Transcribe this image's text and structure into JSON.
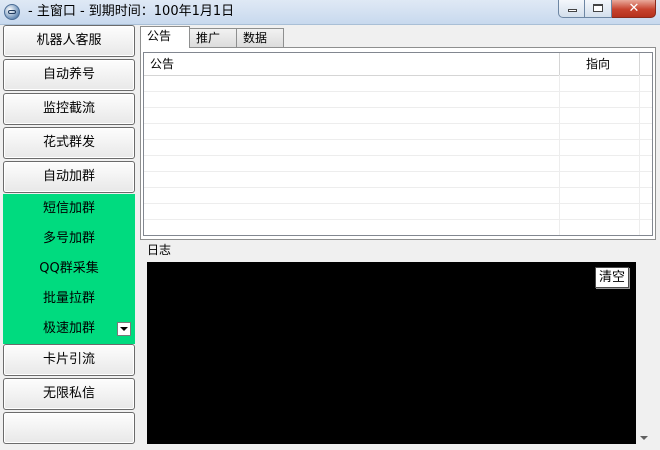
{
  "window": {
    "title": "- 主窗口 -  到期时间：100年1月1日"
  },
  "nav": {
    "items": [
      {
        "label": "机器人客服"
      },
      {
        "label": "自动养号"
      },
      {
        "label": "监控截流"
      },
      {
        "label": "花式群发"
      },
      {
        "label": "自动加群"
      }
    ],
    "submenu": [
      {
        "label": "短信加群"
      },
      {
        "label": "多号加群"
      },
      {
        "label": "QQ群采集"
      },
      {
        "label": "批量拉群"
      },
      {
        "label": "极速加群"
      }
    ],
    "items_after": [
      {
        "label": "卡片引流"
      },
      {
        "label": "无限私信"
      },
      {
        "label": ""
      }
    ],
    "submenu_color": "#00db7f"
  },
  "tabs": [
    {
      "label": "公告",
      "active": true
    },
    {
      "label": "推广",
      "active": false
    },
    {
      "label": "数据",
      "active": false
    }
  ],
  "announcement_list": {
    "columns": [
      "公告",
      "指向"
    ],
    "rows": []
  },
  "log": {
    "label": "日志",
    "clear_label": "清空",
    "content": ""
  }
}
